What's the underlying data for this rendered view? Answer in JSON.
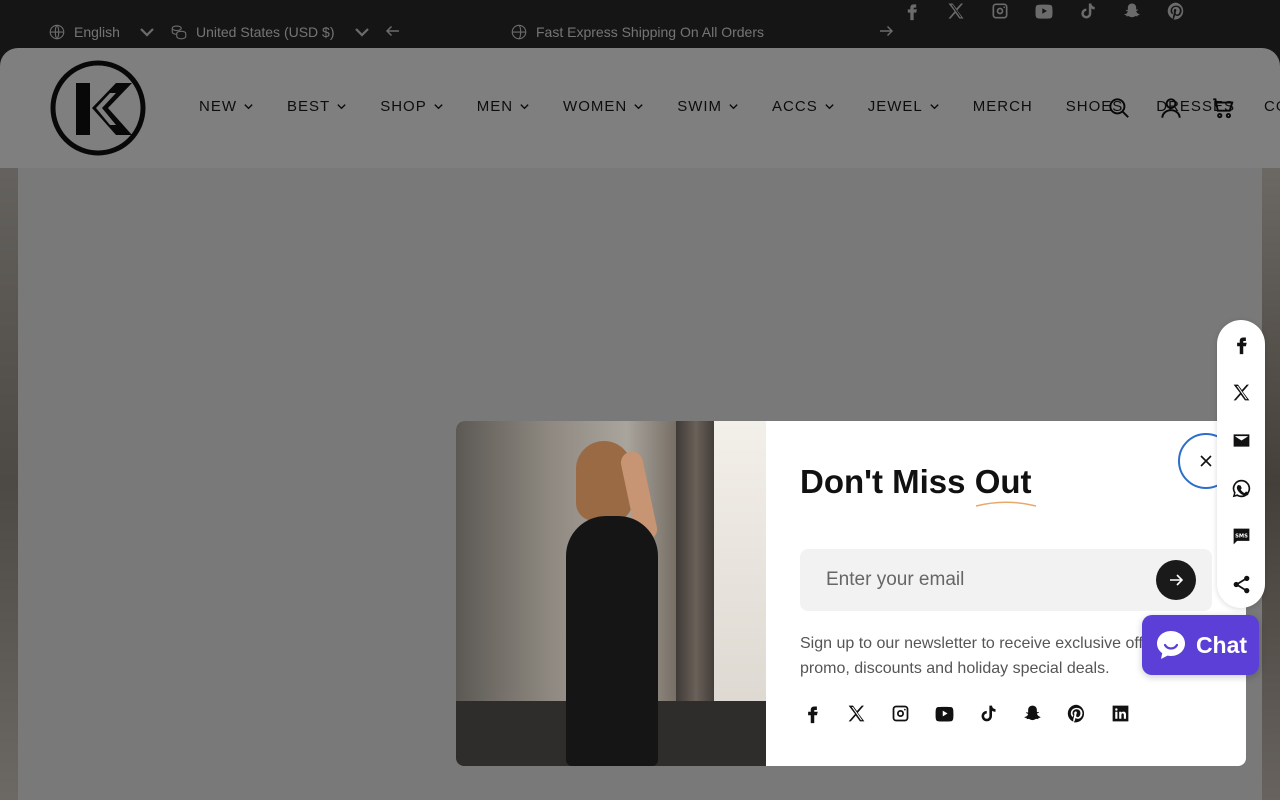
{
  "topbar": {
    "language": "English",
    "currency": "United States (USD $)",
    "announcement": "Fast Express Shipping On All Orders",
    "social_icons": [
      "facebook-icon",
      "x-icon",
      "instagram-icon",
      "youtube-icon",
      "tiktok-icon",
      "snapchat-icon",
      "pinterest-icon"
    ]
  },
  "header": {
    "nav": [
      {
        "label": "NEW",
        "dropdown": true
      },
      {
        "label": "BEST",
        "dropdown": true
      },
      {
        "label": "SHOP",
        "dropdown": true
      },
      {
        "label": "MEN",
        "dropdown": true
      },
      {
        "label": "WOMEN",
        "dropdown": true
      },
      {
        "label": "SWIM",
        "dropdown": true
      },
      {
        "label": "ACCS",
        "dropdown": true
      },
      {
        "label": "JEWEL",
        "dropdown": true
      },
      {
        "label": "MERCH",
        "dropdown": false
      },
      {
        "label": "SHOES",
        "dropdown": false
      },
      {
        "label": "DRESSES",
        "dropdown": false
      }
    ],
    "nav_clipped": "CO",
    "icons": [
      "search-icon",
      "account-icon",
      "cart-icon"
    ]
  },
  "popup": {
    "title_part1": "Don't Miss ",
    "title_part2": "Out",
    "email_placeholder": "Enter your email",
    "description": "Sign up to our newsletter to receive exclusive offers, promo, discounts and holiday special deals.",
    "social_icons": [
      "facebook-icon",
      "x-icon",
      "instagram-icon",
      "youtube-icon",
      "tiktok-icon",
      "snapchat-icon",
      "pinterest-icon",
      "linkedin-icon"
    ]
  },
  "share_bar": [
    "facebook-icon",
    "x-icon",
    "email-icon",
    "whatsapp-icon",
    "sms-icon",
    "share-icon"
  ],
  "chat": {
    "label": "Chat"
  },
  "colors": {
    "accent": "#5b3fd6",
    "focus_ring": "#2c6ecb",
    "topbar": "#2b2b2b"
  }
}
